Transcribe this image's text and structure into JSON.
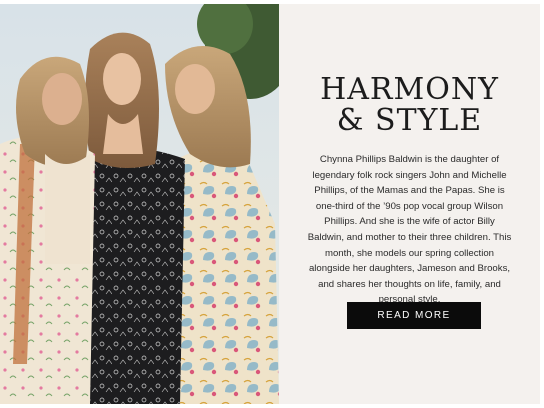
{
  "hero": {
    "headline_line1": "HARMONY",
    "headline_line2": "& STYLE",
    "body": "Chynna Phillips Baldwin is the daughter of legendary folk rock singers John and Michelle Phillips, of the Mamas and the Papas. She is one-third of the ’90s pop vocal group Wilson Phillips. And she is the wife of actor Billy Baldwin, and mother to their three children. This month, she models our spring collection alongside her daughters, Jameson and Brooks, and shares her thoughts on life, family, and personal style.",
    "cta_label": "READ MORE"
  },
  "colors": {
    "panel_background": "#f4f1ee",
    "button_background": "#0b0b0b",
    "button_text": "#ffffff",
    "text": "#1c1c1c"
  }
}
